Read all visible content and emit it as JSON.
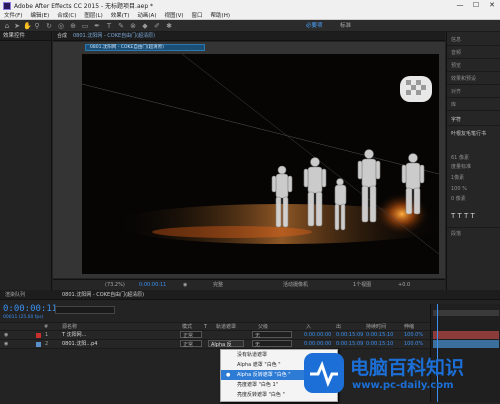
{
  "window": {
    "title": "Adobe After Effects CC 2015 - 无标题项目.aep *",
    "controls": [
      "—",
      "☐",
      "✕"
    ]
  },
  "menu": [
    "文件(F)",
    "编辑(E)",
    "合成(C)",
    "图层(L)",
    "效果(T)",
    "动画(A)",
    "视图(V)",
    "窗口",
    "帮助(H)"
  ],
  "workspace": {
    "active": "必要项",
    "other": "标准"
  },
  "left_panel": {
    "tab": "效果控件"
  },
  "composition": {
    "tab": "合成",
    "tab_name": "0801.沈阳网 - COKE自由门(超清原)",
    "breadcrumb": "0801.沈阳网 - COKE自由门(超清原)"
  },
  "viewer_bar": {
    "zoom": "(73.2%)",
    "timecode": "0:00:00:11",
    "quality": "完整",
    "camera": "活动摄像机",
    "views": "1个视图",
    "exposure": "+0.0"
  },
  "right_panel": {
    "items": [
      "信息",
      "音频",
      "预览",
      "效果和预设",
      "对齐",
      "库",
      "字符",
      "段落"
    ],
    "character": {
      "font": "叶根友毛笔行书",
      "size": "61 像素",
      "leading": "自动",
      "tracking": "度量标准",
      "stroke": "1像素",
      "scale_v": "100 %",
      "scale_h": "100 %",
      "baseline": "0 像素"
    }
  },
  "timeline": {
    "tabs": [
      "渲染队列",
      "0801.沈阳网 - COKE自由门(超清原)"
    ],
    "timecode": "0:00:00:11",
    "fps": "00011 (25.00 fps)",
    "columns": [
      "#",
      "源名称",
      "模式",
      "T",
      "轨道遮罩",
      "父级",
      "入",
      "出",
      "持续时间",
      "伸缩"
    ],
    "layers": [
      {
        "num": "1",
        "name": "T 沈阳网...",
        "mode": "正常",
        "trkmat": "",
        "parent": "无",
        "in": "0:00:00:00",
        "out": "0:00:15:09",
        "dur": "0:00:15:10",
        "stretch": "100.0%",
        "color": "#c8302e"
      },
      {
        "num": "2",
        "name": "0801.沈阳...p4",
        "mode": "正常",
        "trkmat": "Alpha 反",
        "parent": "无",
        "in": "0:00:00:00",
        "out": "0:00:15:09",
        "dur": "0:00:15:10",
        "stretch": "100.0%",
        "color": "#5a8fc9"
      }
    ]
  },
  "dropdown": {
    "items": [
      "没有轨道遮罩",
      "Alpha 遮罩 \"白色 \"",
      "Alpha 反转遮罩 \"白色 \"",
      "亮度遮罩 \"白色 1\"",
      "亮度反转遮罩 \"白色 \""
    ],
    "selected_index": 2
  },
  "watermark": {
    "title": "电脑百科知识",
    "url": "www.pc-daily.com"
  }
}
